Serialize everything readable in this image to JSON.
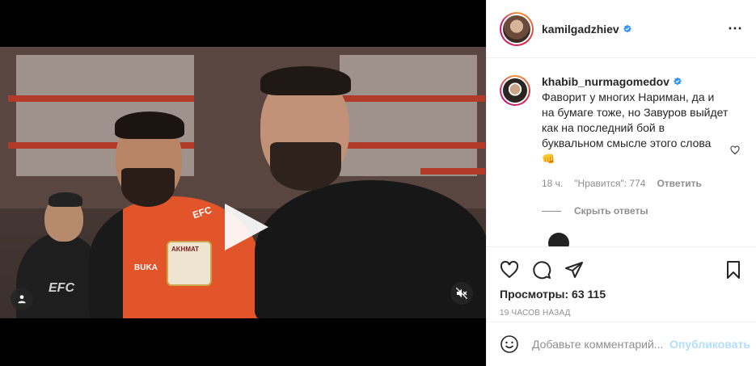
{
  "post": {
    "author": "kamilgadzhiev",
    "more_icon": "⋯"
  },
  "video": {
    "jersey_brand": "EFC",
    "jersey_sponsor": "BUKA",
    "jersey_badge": "AKHMAT",
    "left_jersey_brand": "EFC"
  },
  "comment": {
    "user": "khabib_nurmagomedov",
    "text": "Фаворит у многих Нариман, да и на бумаге тоже, но Завуров выйдет как на последний бой в буквальном смысле этого слова",
    "emoji": "👊",
    "time": "18 ч.",
    "likes": "\"Нравится\": 774",
    "reply": "Ответить",
    "hide_replies": "Скрыть ответы"
  },
  "actions": {
    "views": "Просмотры: 63 115",
    "posted_ago": "19 часов назад"
  },
  "composer": {
    "placeholder": "Добавьте комментарий...",
    "publish": "Опубликовать"
  },
  "colors": {
    "verified": "#3897f0",
    "publish_disabled": "#b2dffc",
    "muted_text": "#8e8e8e"
  }
}
